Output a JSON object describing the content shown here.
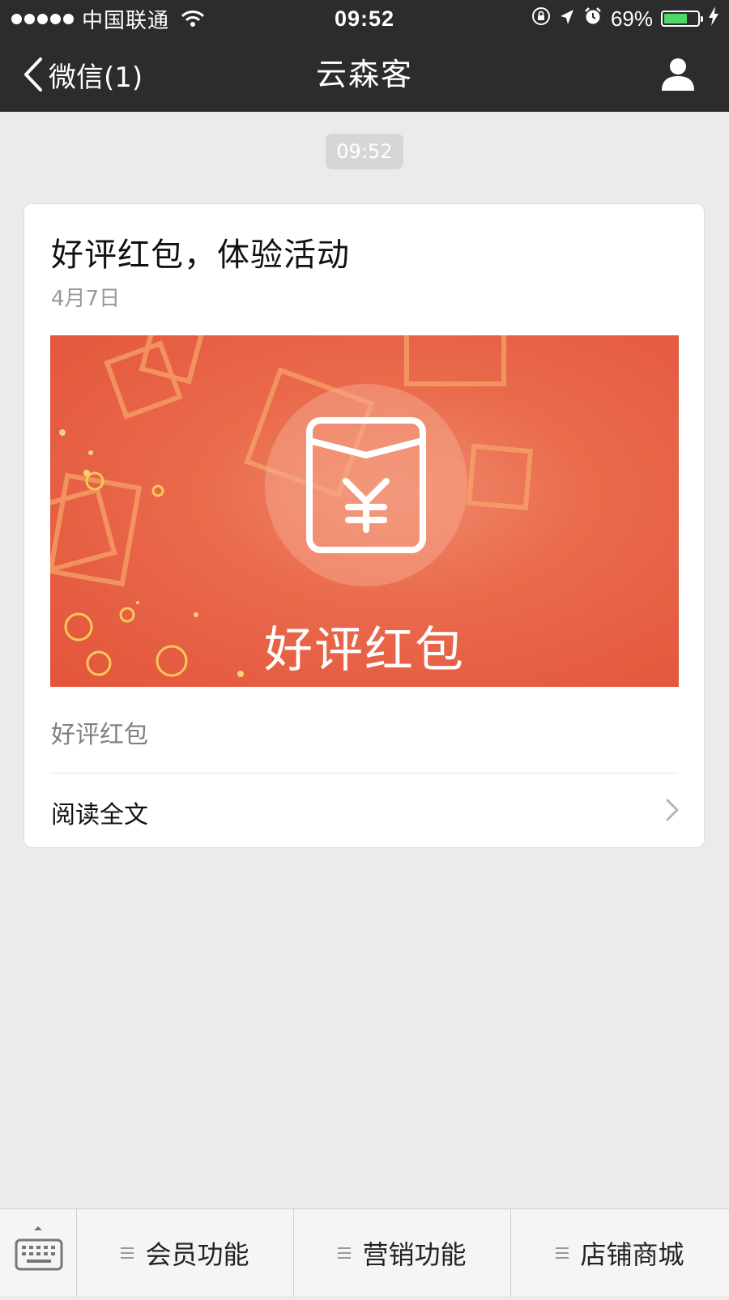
{
  "status_bar": {
    "carrier": "中国联通",
    "time": "09:52",
    "battery_percent": "69%",
    "battery_level": 0.69,
    "icons": [
      "signal-dots-icon",
      "wifi-icon",
      "orientation-lock-icon",
      "location-arrow-icon",
      "alarm-icon",
      "battery-icon",
      "charging-bolt-icon"
    ]
  },
  "nav": {
    "back_label": "微信(1)",
    "title": "云森客",
    "icons": [
      "back-chevron-icon",
      "profile-icon"
    ]
  },
  "chat": {
    "timestamp": "09:52"
  },
  "article": {
    "title": "好评红包，体验活动",
    "date": "4月7日",
    "cover_caption": "好评红包",
    "digest": "好评红包",
    "read_more_label": "阅读全文"
  },
  "bottom_menu": {
    "keyboard_icon": "keyboard-icon",
    "items": [
      {
        "label": "会员功能"
      },
      {
        "label": "营销功能"
      },
      {
        "label": "店铺商城"
      }
    ]
  }
}
